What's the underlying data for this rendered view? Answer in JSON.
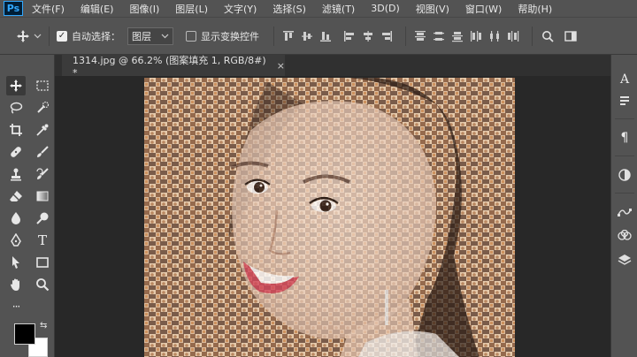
{
  "app": {
    "logo": "Ps"
  },
  "menu": [
    "文件(F)",
    "编辑(E)",
    "图像(I)",
    "图层(L)",
    "文字(Y)",
    "选择(S)",
    "滤镜(T)",
    "3D(D)",
    "视图(V)",
    "窗口(W)",
    "帮助(H)"
  ],
  "options": {
    "auto_select_label": "自动选择：",
    "auto_select_checked": true,
    "auto_select_target": "图层",
    "show_transform_label": "显示变换控件",
    "show_transform_checked": false
  },
  "document": {
    "tab_title": "1314.jpg @ 66.2% (图案填充 1, RGB/8#) *",
    "close_glyph": "×"
  },
  "tools": [
    "move-tool",
    "marquee-tool",
    "lasso-tool",
    "magic-wand-tool",
    "crop-tool",
    "eyedropper-tool",
    "healing-brush-tool",
    "brush-tool",
    "clone-stamp-tool",
    "history-brush-tool",
    "eraser-tool",
    "gradient-tool",
    "blur-tool",
    "dodge-tool",
    "pen-tool",
    "type-tool",
    "path-selection-tool",
    "rectangle-tool",
    "hand-tool",
    "zoom-tool",
    "more-tools"
  ],
  "toolbar": {
    "type_glyph": "T",
    "more_glyph": "···",
    "swap_glyph": "⇆"
  },
  "colors": {
    "foreground": "#000000",
    "background": "#ffffff",
    "accent": "#31a8ff"
  },
  "dock": {
    "type_glyph": "A",
    "paragraph_glyph": "¶"
  }
}
